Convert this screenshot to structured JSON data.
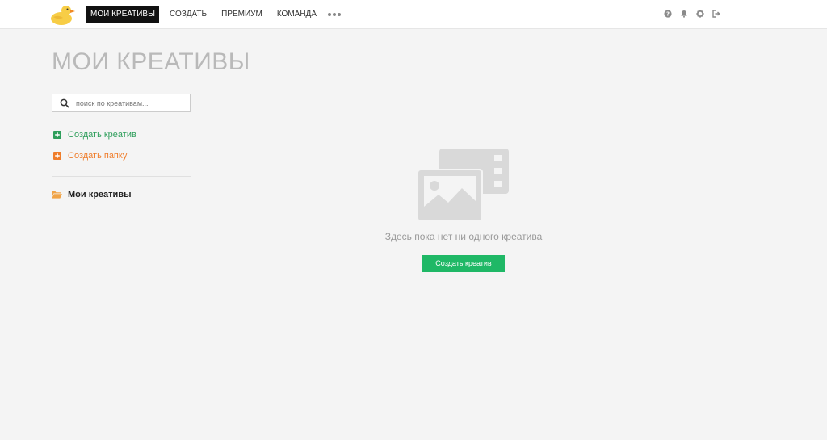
{
  "nav": {
    "items": [
      {
        "label": "МОИ КРЕАТИВЫ",
        "active": true
      },
      {
        "label": "СОЗДАТЬ",
        "active": false
      },
      {
        "label": "ПРЕМИУМ",
        "active": false
      },
      {
        "label": "КОМАНДА",
        "active": false
      }
    ],
    "more_icon": "ellipsis-icon"
  },
  "top_icons": [
    "help-icon",
    "bell-icon",
    "gear-icon",
    "logout-icon"
  ],
  "page": {
    "title": "МОИ КРЕАТИВЫ"
  },
  "sidebar": {
    "search_placeholder": "поиск по креативам...",
    "create_creative_label": "Создать креатив",
    "create_folder_label": "Создать папку",
    "folder_label": "Мои креативы"
  },
  "empty_state": {
    "message": "Здесь пока нет ни одного креатива",
    "button_label": "Создать креатив"
  },
  "colors": {
    "brand_green": "#1fb866",
    "link_green": "#2e9e5b",
    "accent_orange": "#ef7d2b",
    "nav_active_bg": "#111111",
    "logo_yellow": "#f7cd46"
  }
}
